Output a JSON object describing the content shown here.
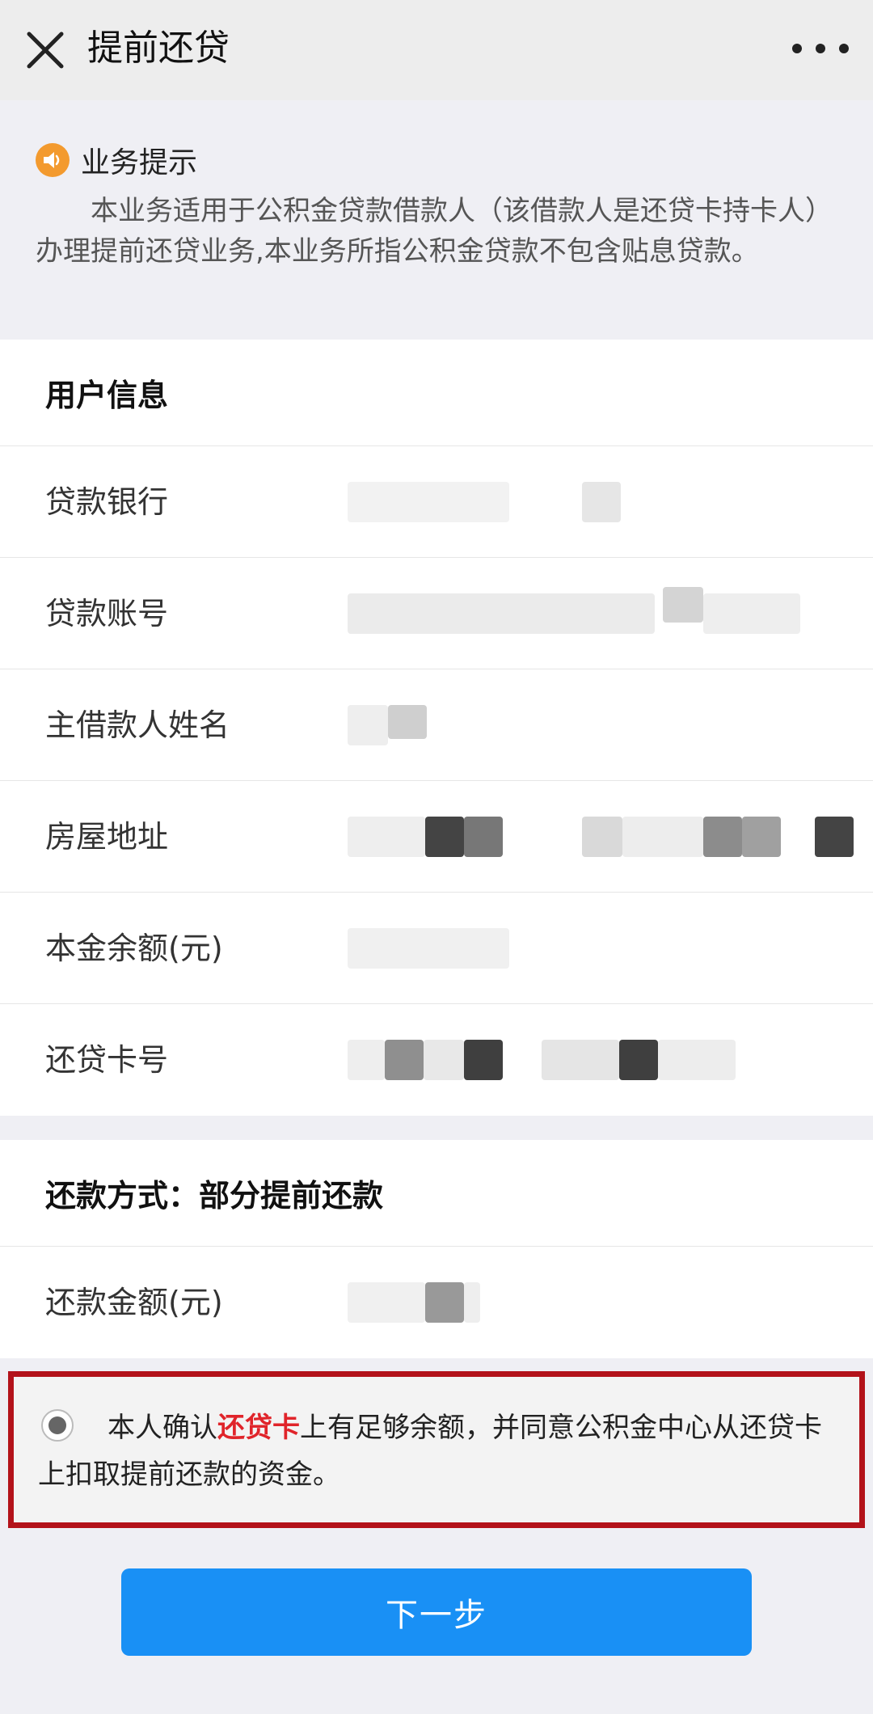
{
  "header": {
    "title": "提前还贷"
  },
  "notice": {
    "title": "业务提示",
    "body": "本业务适用于公积金贷款借款人（该借款人是还贷卡持卡人）办理提前还贷业务,本业务所指公积金贷款不包含贴息贷款。"
  },
  "user_info": {
    "title": "用户信息",
    "rows": [
      {
        "label": "贷款银行"
      },
      {
        "label": "贷款账号"
      },
      {
        "label": "主借款人姓名"
      },
      {
        "label": "房屋地址"
      },
      {
        "label": "本金余额(元)"
      },
      {
        "label": "还贷卡号"
      }
    ]
  },
  "repayment": {
    "title": "还款方式：部分提前还款",
    "amount_label": "还款金额(元)"
  },
  "confirm": {
    "text_before": "本人确认",
    "highlight": "还贷卡",
    "text_after": "上有足够余额，并同意公积金中心从还贷卡上扣取提前还款的资金。"
  },
  "next_button": "下一步",
  "colors": {
    "accent": "#1990f5",
    "highlight_red": "#e0242a",
    "frame_red": "#b3121a",
    "notice_icon": "#f39a2e"
  }
}
